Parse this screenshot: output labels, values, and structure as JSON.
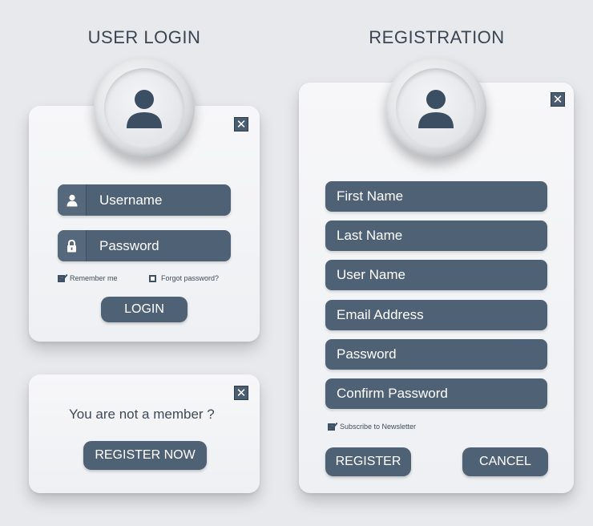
{
  "login": {
    "heading": "USER LOGIN",
    "close_glyph": "✕",
    "avatar_icon": "user-icon",
    "username_placeholder": "Username",
    "password_placeholder": "Password",
    "remember_label": "Remember me",
    "remember_checked": true,
    "forgot_label": "Forgot password?",
    "forgot_checked": false,
    "login_button": "LOGIN"
  },
  "member": {
    "close_glyph": "✕",
    "prompt": "You are not a member ?",
    "register_now_button": "REGISTER NOW"
  },
  "registration": {
    "heading": "REGISTRATION",
    "close_glyph": "✕",
    "avatar_icon": "user-icon",
    "fields": [
      "First Name",
      "Last Name",
      "User Name",
      "Email Address",
      "Password",
      "Confirm Password"
    ],
    "subscribe_label": "Subscribe to Newsletter",
    "subscribe_checked": true,
    "register_button": "REGISTER",
    "cancel_button": "CANCEL"
  },
  "colors": {
    "background": "#e8e9ed",
    "field": "#4f6275",
    "text_dark": "#3a4552",
    "card": "#f4f5f7"
  }
}
